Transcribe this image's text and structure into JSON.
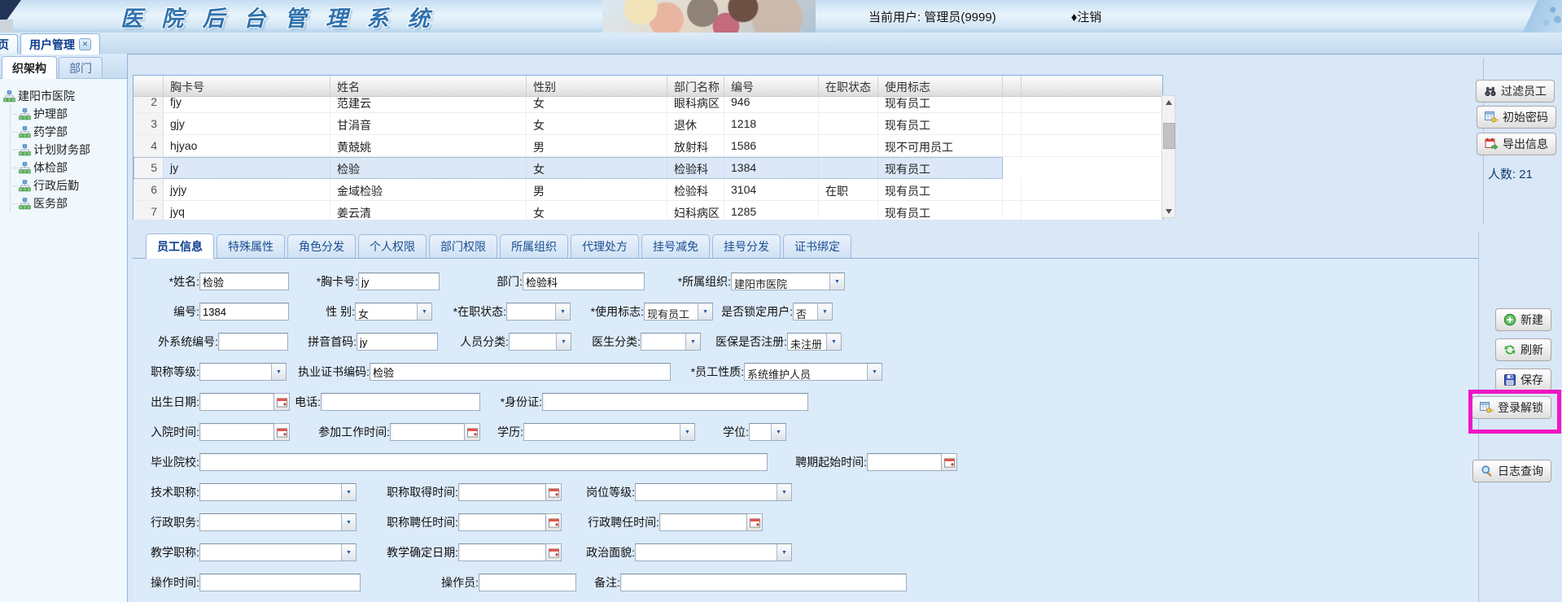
{
  "header": {
    "title": "医 院 后 台 管 理 系 统",
    "current_user": "当前用户: 管理员(9999)",
    "logout": "♦注销"
  },
  "main_tabs": [
    {
      "label": "页"
    },
    {
      "label": "用户管理"
    }
  ],
  "sidebar": {
    "tabs": [
      {
        "label": "织架构"
      },
      {
        "label": "部门"
      }
    ],
    "tree": {
      "root": "建阳市医院",
      "children": [
        "护理部",
        "药学部",
        "计划财务部",
        "体检部",
        "行政后勤",
        "医务部"
      ]
    }
  },
  "grid": {
    "columns": [
      "",
      "胸卡号",
      "姓名",
      "性别",
      "部门名称",
      "编号",
      "在职状态",
      "使用标志"
    ],
    "rows": [
      {
        "num": "2",
        "badge": "fjy",
        "name": "范建云",
        "sex": "女",
        "dept": "眼科病区",
        "code": "946",
        "status": "",
        "flag": "现有员工"
      },
      {
        "num": "3",
        "badge": "gjy",
        "name": "甘涓音",
        "sex": "女",
        "dept": "退休",
        "code": "1218",
        "status": "",
        "flag": "现有员工"
      },
      {
        "num": "4",
        "badge": "hjyao",
        "name": "黄兢姚",
        "sex": "男",
        "dept": "放射科",
        "code": "1586",
        "status": "",
        "flag": "现不可用员工"
      },
      {
        "num": "5",
        "badge": "jy",
        "name": "检验",
        "sex": "女",
        "dept": "检验科",
        "code": "1384",
        "status": "",
        "flag": "现有员工"
      },
      {
        "num": "6",
        "badge": "jyjy",
        "name": "金域检验",
        "sex": "男",
        "dept": "检验科",
        "code": "3104",
        "status": "在职",
        "flag": "现有员工"
      },
      {
        "num": "7",
        "badge": "jyq",
        "name": "姜云清",
        "sex": "女",
        "dept": "妇科病区",
        "code": "1285",
        "status": "",
        "flag": "现有员工"
      }
    ],
    "count": "人数: 21"
  },
  "grid_actions": {
    "filter": "过滤员工",
    "init_password": "初始密码",
    "export": "导出信息"
  },
  "detail_tabs": [
    "员工信息",
    "特殊属性",
    "角色分发",
    "个人权限",
    "部门权限",
    "所属组织",
    "代理处方",
    "挂号减免",
    "挂号分发",
    "证书绑定"
  ],
  "form": {
    "fields": {
      "name": {
        "label": "*姓名:",
        "value": "检验"
      },
      "badge": {
        "label": "*胸卡号:",
        "value": "jy"
      },
      "dept": {
        "label": "部门:",
        "value": "检验科"
      },
      "org": {
        "label": "*所属组织:",
        "value": "建阳市医院"
      },
      "code": {
        "label": "编号:",
        "value": "1384"
      },
      "sex": {
        "label": "性 别:",
        "value": "女"
      },
      "job_status": {
        "label": "*在职状态:",
        "value": ""
      },
      "use_flag": {
        "label": "*使用标志:",
        "value": "现有员工"
      },
      "locked": {
        "label": "是否锁定用户:",
        "value": "否"
      },
      "ext_code": {
        "label": "外系统编号:",
        "value": ""
      },
      "pinyin": {
        "label": "拼音首码:",
        "value": "jy"
      },
      "person_class": {
        "label": "人员分类:",
        "value": ""
      },
      "doctor_class": {
        "label": "医生分类:",
        "value": ""
      },
      "insurance": {
        "label": "医保是否注册:",
        "value": "未注册"
      },
      "title_level": {
        "label": "职称等级:",
        "value": ""
      },
      "license_code": {
        "label": "执业证书编码:",
        "value": "检验"
      },
      "emp_nature": {
        "label": "*员工性质:",
        "value": "系统维护人员"
      },
      "birth_date": {
        "label": "出生日期:",
        "value": ""
      },
      "phone": {
        "label": "电话:",
        "value": ""
      },
      "id_card": {
        "label": "*身份证:",
        "value": ""
      },
      "admission_time": {
        "label": "入院时间:",
        "value": ""
      },
      "work_start_time": {
        "label": "参加工作时间:",
        "value": ""
      },
      "education": {
        "label": "学历:",
        "value": ""
      },
      "degree": {
        "label": "学位:",
        "value": ""
      },
      "school": {
        "label": "毕业院校:",
        "value": ""
      },
      "hire_start_time": {
        "label": "聘期起始时间:",
        "value": ""
      },
      "tech_title": {
        "label": "技术职称:",
        "value": ""
      },
      "title_get_time": {
        "label": "职称取得时间:",
        "value": ""
      },
      "post_level": {
        "label": "岗位等级:",
        "value": ""
      },
      "admin_post": {
        "label": "行政职务:",
        "value": ""
      },
      "title_hire_time": {
        "label": "职称聘任时间:",
        "value": ""
      },
      "admin_hire_time": {
        "label": "行政聘任时间:",
        "value": ""
      },
      "teach_title": {
        "label": "教学职称:",
        "value": ""
      },
      "teach_confirm": {
        "label": "教学确定日期:",
        "value": ""
      },
      "political": {
        "label": "政治面貌:",
        "value": ""
      },
      "op_time": {
        "label": "操作时间:",
        "value": ""
      },
      "operator": {
        "label": "操作员:",
        "value": ""
      },
      "remark": {
        "label": "备注:",
        "value": ""
      }
    }
  },
  "form_actions": {
    "new": "新建",
    "refresh": "刷新",
    "save": "保存",
    "unlock": "登录解锁",
    "log": "日志查询"
  },
  "colors": {
    "highlight": "#ef16c3",
    "accent_blue": "#0b3c8c",
    "selected_row": "#dce8f8"
  }
}
